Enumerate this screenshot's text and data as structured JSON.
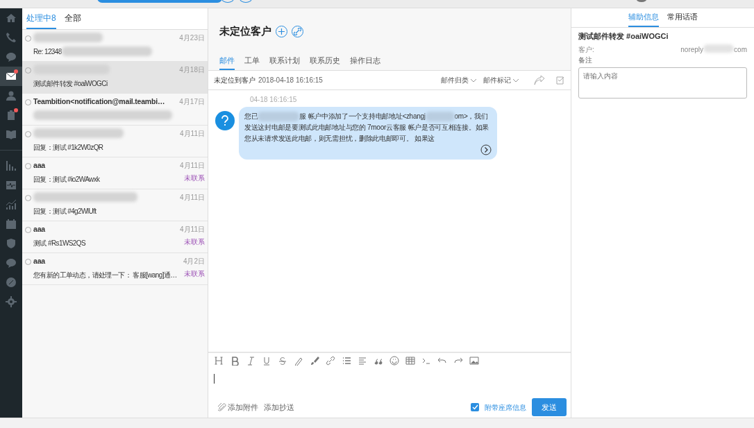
{
  "sidebar": {
    "groups": [
      {
        "items": [
          {
            "selected": false,
            "badge": false
          },
          {
            "selected": false,
            "badge": false
          },
          {
            "selected": false,
            "badge": false
          },
          {
            "selected": true,
            "badge": true
          },
          {
            "selected": false,
            "badge": false
          },
          {
            "selected": false,
            "badge": true
          },
          {
            "selected": false,
            "badge": false
          }
        ]
      },
      {
        "items": [
          {
            "selected": false,
            "badge": false
          },
          {
            "selected": false,
            "badge": false
          },
          {
            "selected": false,
            "badge": false
          },
          {
            "selected": false,
            "badge": false
          },
          {
            "selected": false,
            "badge": false
          },
          {
            "selected": false,
            "badge": false
          },
          {
            "selected": false,
            "badge": false
          },
          {
            "selected": false,
            "badge": false
          }
        ]
      }
    ]
  },
  "list_tabs": [
    {
      "label": "处理中8",
      "selected": true
    },
    {
      "label": "全部",
      "selected": false
    }
  ],
  "conversations": [
    {
      "sender_hidden": true,
      "date": "4月23日",
      "subject": "Re: 12348",
      "subject_hidden": true,
      "selected": false
    },
    {
      "sender_hidden": true,
      "date": "4月18日",
      "subject": "测试邮件转发 #oaiWOGCi",
      "selected": true
    },
    {
      "sender": "Teambition<notification@mail.teambi…",
      "date": "4月17日",
      "subject_hidden": true,
      "selected": false
    },
    {
      "sender_hidden": true,
      "date": "4月11日",
      "subject": "回复：测试 #1k2W0zQR",
      "selected": false
    },
    {
      "sender": "aaa",
      "date": "4月11日",
      "subject": "回复：测试 #io2WAwxk",
      "status": "未联系",
      "selected": false
    },
    {
      "sender_hidden": true,
      "date": "4月11日",
      "subject": "回复：测试 #4g2WlUft",
      "selected": false
    },
    {
      "sender": "aaa",
      "date": "4月11日",
      "subject": "测试 #Rs1WS2QS",
      "status": "未联系",
      "selected": false
    },
    {
      "sender": "aaa",
      "date": "4月2日",
      "subject": "您有新的工单动态，请处理一下： 客服[wang]通…",
      "status": "未联系",
      "selected": false
    }
  ],
  "customer": {
    "title": "未定位客户"
  },
  "tabs": [
    {
      "label": "邮件",
      "selected": true
    },
    {
      "label": "工单",
      "selected": false
    },
    {
      "label": "联系计划",
      "selected": false
    },
    {
      "label": "联系历史",
      "selected": false
    },
    {
      "label": "操作日志",
      "selected": false
    }
  ],
  "mail_header": {
    "status": "未定位到客户",
    "time": "2018-04-18 16:16:15",
    "dropdowns": [
      "邮件归类",
      "邮件标记"
    ]
  },
  "message": {
    "time": "04-18 16:16:15",
    "parts": [
      {
        "kind": "text",
        "text": "您已"
      },
      {
        "kind": "redacted"
      },
      {
        "kind": "text",
        "text": "服 帐户中添加了一个支持电邮地址<zhangj"
      },
      {
        "kind": "redacted"
      },
      {
        "kind": "text",
        "text": "om"
      },
      {
        "kind": "text",
        "text": ">，我们发送这封电邮是要测试此电邮地址与您的 7moor云客服 帐户是否可互相连接。如果您从未请求发送此电邮，则无需担忧，删除此电邮即可。 如果这"
      }
    ]
  },
  "editor": {
    "attach": "添加附件",
    "cc": "添加抄送",
    "signature": {
      "label": "附带座席信息",
      "checked": true
    },
    "send": "发送"
  },
  "side_tabs": [
    {
      "label": "辅助信息",
      "selected": true
    },
    {
      "label": "常用话语",
      "selected": false
    }
  ],
  "side_info": {
    "title": "测试邮件转发 #oaiWOGCi",
    "customer_label": "客户:",
    "customer_value_start": "noreply",
    "customer_value_end": "com",
    "note_label": "备注",
    "note_placeholder": "请输入内容"
  }
}
